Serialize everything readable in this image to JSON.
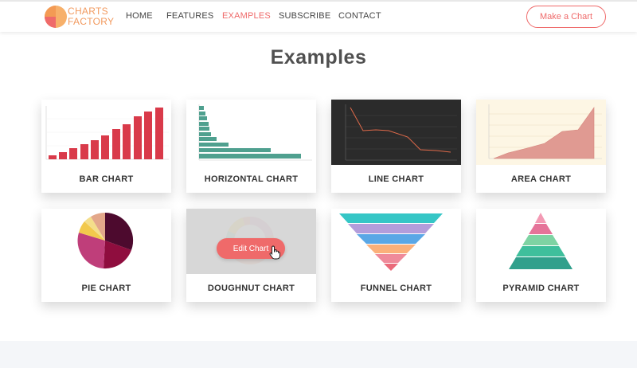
{
  "brand": {
    "line1": "CHARTS",
    "line2": "FACTORY",
    "colors": {
      "primary": "#f29a5f",
      "accent": "#ef6a6a"
    }
  },
  "nav": {
    "items": [
      {
        "label": "HOME",
        "active": false
      },
      {
        "label": "FEATURES",
        "active": false
      },
      {
        "label": "EXAMPLES",
        "active": true
      },
      {
        "label": "SUBSCRIBE",
        "active": false
      },
      {
        "label": "CONTACT",
        "active": false
      }
    ],
    "cta_label": "Make a Chart"
  },
  "page": {
    "title": "Examples"
  },
  "examples": [
    {
      "label": "BAR CHART",
      "icon": "bar-chart-thumbnail"
    },
    {
      "label": "HORIZONTAL CHART",
      "icon": "horizontal-chart-thumbnail"
    },
    {
      "label": "LINE CHART",
      "icon": "line-chart-thumbnail"
    },
    {
      "label": "AREA CHART",
      "icon": "area-chart-thumbnail"
    },
    {
      "label": "PIE CHART",
      "icon": "pie-chart-thumbnail"
    },
    {
      "label": "DOUGHNUT CHART",
      "icon": "doughnut-chart-thumbnail",
      "hover_label": "Edit Chart"
    },
    {
      "label": "FUNNEL CHART",
      "icon": "funnel-chart-thumbnail"
    },
    {
      "label": "PYRAMID CHART",
      "icon": "pyramid-chart-thumbnail"
    }
  ]
}
